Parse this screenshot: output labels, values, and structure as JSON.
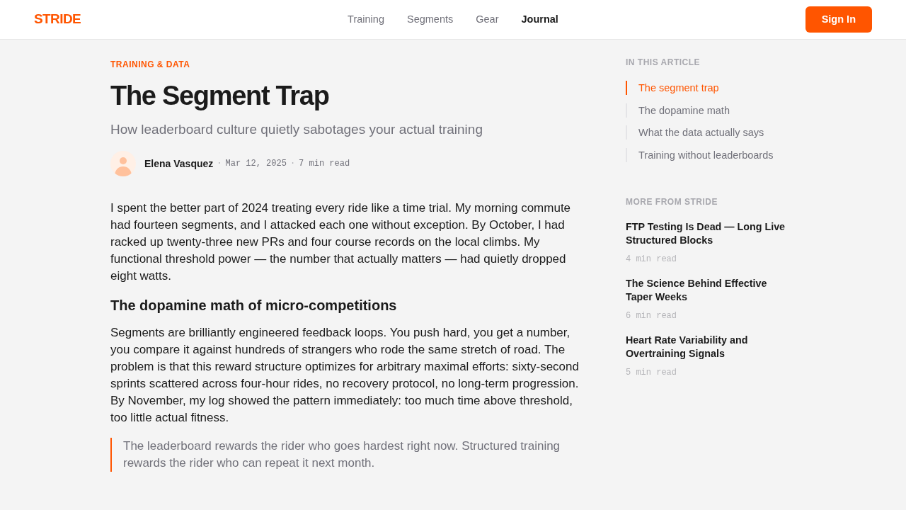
{
  "brand": {
    "logo": "STRIDE"
  },
  "nav": {
    "links": [
      {
        "label": "Training",
        "selected": false
      },
      {
        "label": "Segments",
        "selected": false
      },
      {
        "label": "Gear",
        "selected": false
      },
      {
        "label": "Journal",
        "selected": true
      }
    ],
    "sign_in": "Sign In"
  },
  "article": {
    "eyebrow": "TRAINING & DATA",
    "title": "The Segment Trap",
    "subtitle": "How leaderboard culture quietly sabotages your actual training",
    "byline": {
      "author": "Elena Vasquez",
      "meta": [
        {
          "separator": "·",
          "text": "Mar 12, 2025"
        },
        {
          "separator": "·",
          "text": "7 min read"
        }
      ]
    },
    "body": [
      {
        "kind": "paragraph",
        "text": "I spent the better part of 2024 treating every ride like a time trial. My morning commute had fourteen segments, and I attacked each one without exception. By October, I had racked up twenty-three new PRs and four course records on the local climbs. My functional threshold power — the number that actually matters — had quietly dropped eight watts."
      },
      {
        "kind": "heading",
        "text": "The dopamine math of micro-competitions"
      },
      {
        "kind": "paragraph",
        "text": "Segments are brilliantly engineered feedback loops. You push hard, you get a number, you compare it against hundreds of strangers who rode the same stretch of road. The problem is that this reward structure optimizes for arbitrary maximal efforts: sixty-second sprints scattered across four-hour rides, no recovery protocol, no long-term progression. By November, my log showed the pattern immediately: too much time above threshold, too little actual fitness."
      },
      {
        "kind": "quote",
        "text": "The leaderboard rewards the rider who goes hardest right now. Structured training rewards the rider who can repeat it next month."
      }
    ]
  },
  "sidebar": {
    "toc": {
      "heading": "IN THIS ARTICLE",
      "items": [
        {
          "label": "The segment trap",
          "selected": true
        },
        {
          "label": "The dopamine math",
          "selected": false
        },
        {
          "label": "What the data actually says",
          "selected": false
        },
        {
          "label": "Training without leaderboards",
          "selected": false
        }
      ]
    },
    "more": {
      "heading": "MORE FROM STRIDE",
      "items": [
        {
          "title": "FTP Testing Is Dead — Long Live Structured Blocks",
          "read_time": "4 min read"
        },
        {
          "title": "The Science Behind Effective Taper Weeks",
          "read_time": "6 min read"
        },
        {
          "title": "Heart Rate Variability and Overtraining Signals",
          "read_time": "5 min read"
        }
      ]
    }
  }
}
